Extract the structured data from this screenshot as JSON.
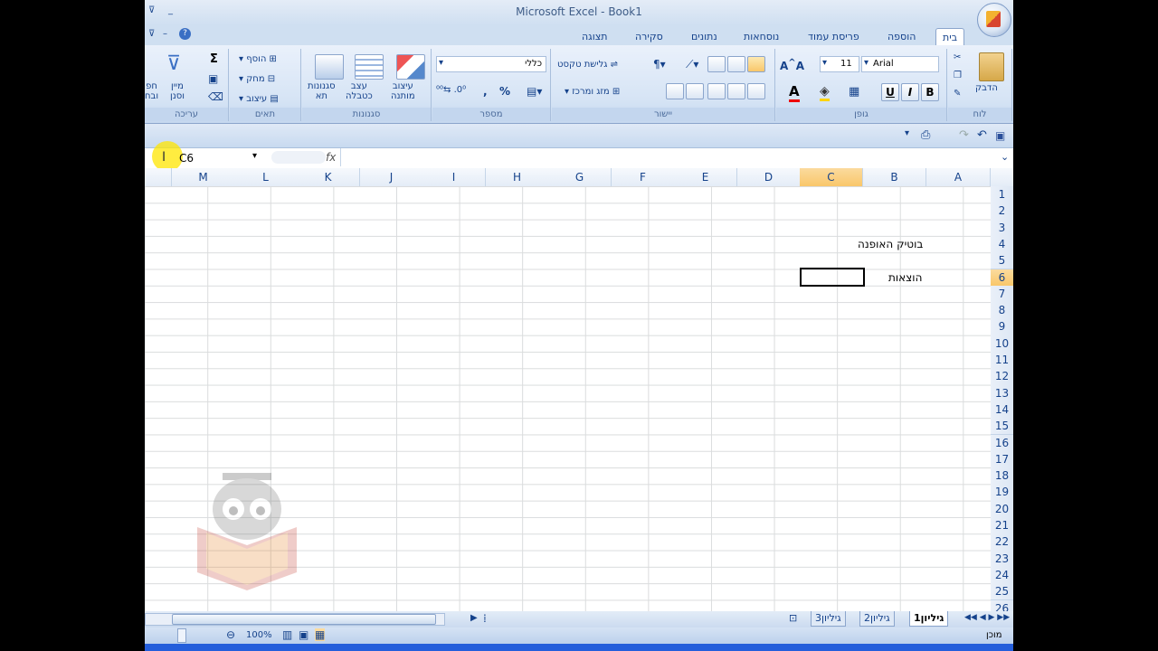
{
  "window": {
    "title": "Microsoft Excel - Book1"
  },
  "tabs": [
    "בית",
    "הוספה",
    "פריסת עמוד",
    "נוסחאות",
    "נתונים",
    "סקירה",
    "תצוגה"
  ],
  "ribbon": {
    "groups": {
      "clipboard": "לוח",
      "font": "גופן",
      "alignment": "יישור",
      "number": "מספר",
      "styles": "סגנונות",
      "cells": "תאים",
      "editing": "עריכה"
    },
    "paste": "הדבק",
    "font_name": "Arial",
    "font_size": "11",
    "wrap_text": "גלישת טקסט",
    "merge_center": "מזג ומרכז",
    "number_format": "כללי",
    "conditional_formatting_1": "עיצוב",
    "conditional_formatting_2": "מותנה",
    "format_table_1": "עצב",
    "format_table_2": "כטבלה",
    "cell_styles_1": "סגנונות",
    "cell_styles_2": "תא",
    "insert": "הוסף",
    "delete": "מחק",
    "format": "עיצוב",
    "sort_1": "מיין",
    "sort_2": "וסנן",
    "find_1": "חפ",
    "find_2": "ובח",
    "bold": "B",
    "italic": "I",
    "underline": "U",
    "percent": "%",
    "sum_icon": "Σ"
  },
  "name_box": "C6",
  "fx": "fx",
  "columns": [
    "A",
    "B",
    "C",
    "D",
    "E",
    "F",
    "G",
    "H",
    "I",
    "J",
    "K",
    "L",
    "M"
  ],
  "rows": [
    "1",
    "2",
    "3",
    "4",
    "5",
    "6",
    "7",
    "8",
    "9",
    "10",
    "11",
    "12",
    "13",
    "14",
    "15",
    "16",
    "17",
    "18",
    "19",
    "20",
    "21",
    "22",
    "23",
    "24",
    "25",
    "26"
  ],
  "cells": {
    "B4": "בוטיק האופנה",
    "B6": "הוצאות"
  },
  "sheets": [
    "גיליון1",
    "גיליון2",
    "גיליון3"
  ],
  "status": "מוכן",
  "zoom": "100%"
}
